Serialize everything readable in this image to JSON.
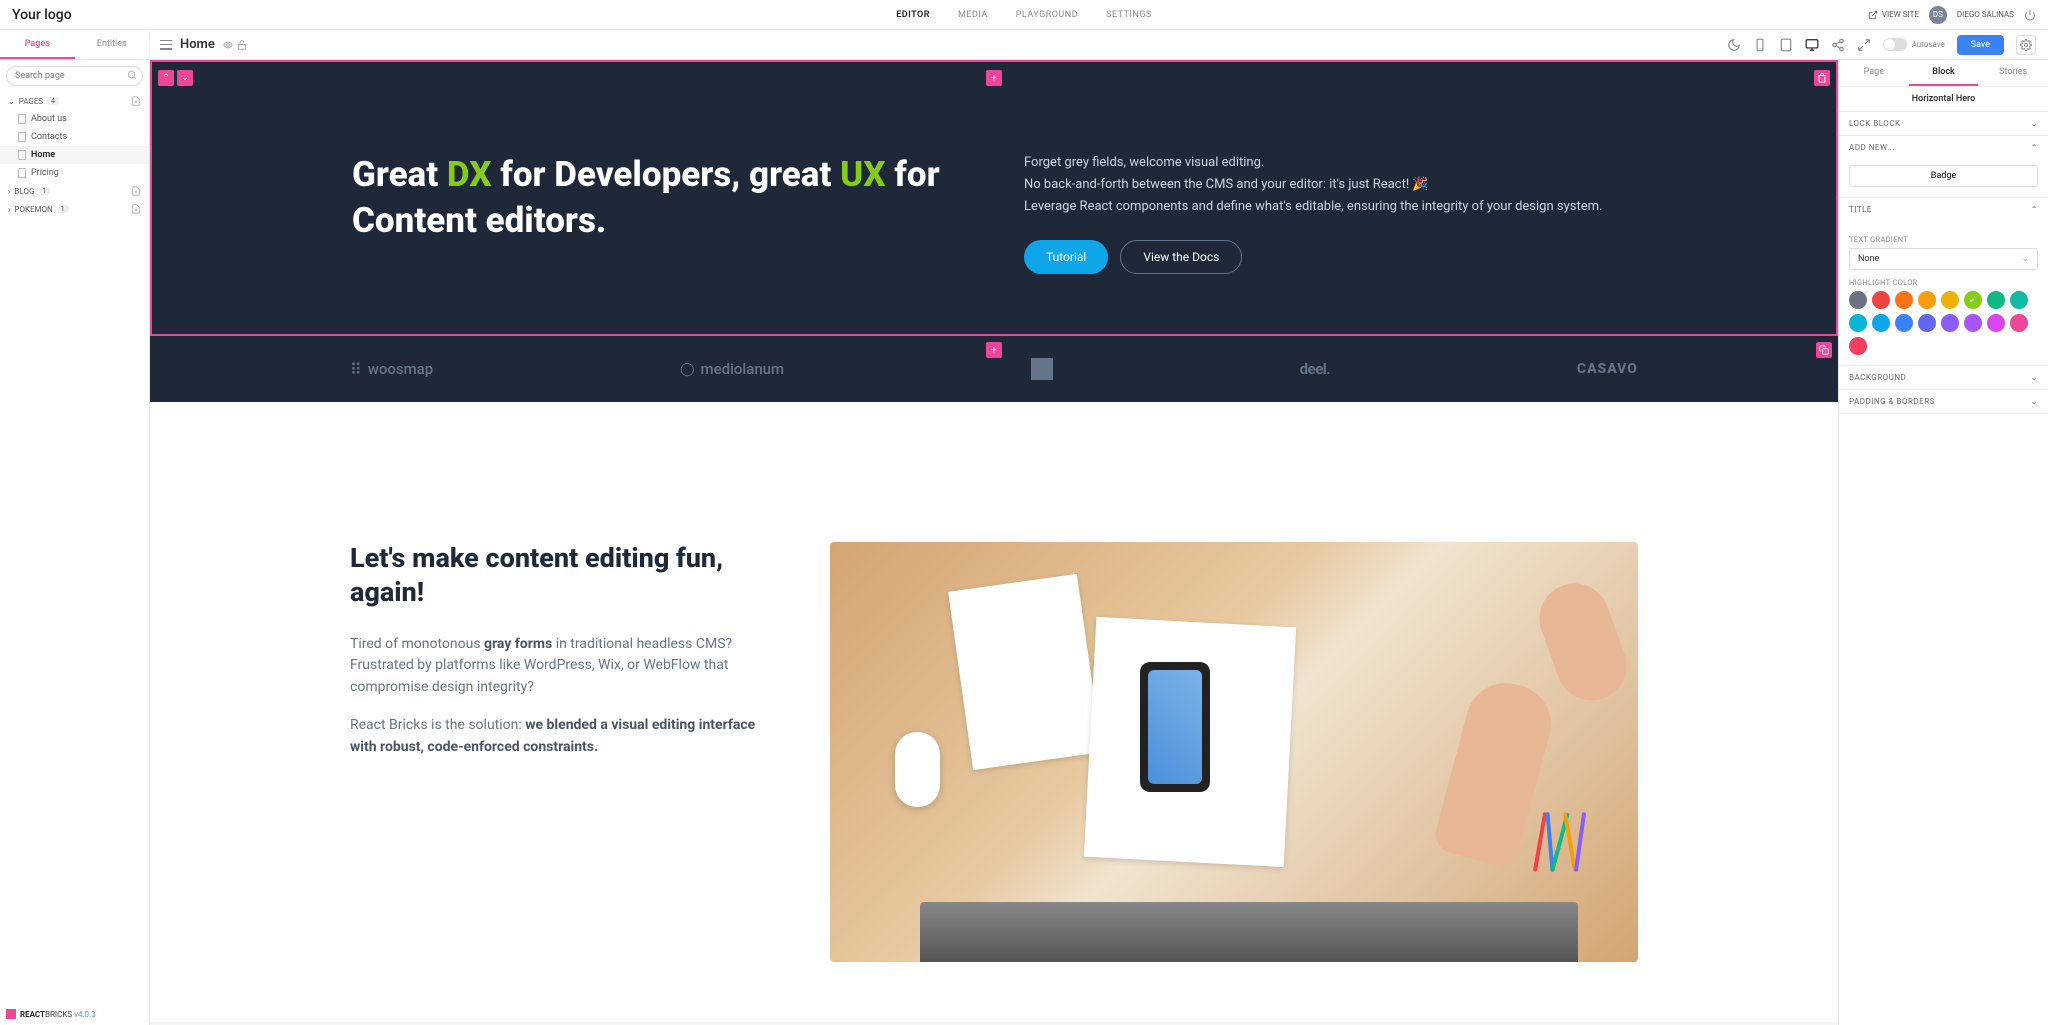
{
  "topnav": {
    "logo": "Your logo",
    "items": [
      "EDITOR",
      "MEDIA",
      "PLAYGROUND",
      "SETTINGS"
    ],
    "viewsite": "VIEW SITE",
    "avatar": "DS",
    "username": "DIEGO SALINAS"
  },
  "secondbar": {
    "tabs": [
      "Pages",
      "Entities"
    ],
    "pagename": "Home",
    "autosave": "Autosave",
    "save": "Save"
  },
  "sidebar": {
    "search_placeholder": "Search page",
    "sections": [
      {
        "label": "PAGES",
        "count": "4",
        "items": [
          {
            "label": "About us"
          },
          {
            "label": "Contacts"
          },
          {
            "label": "Home",
            "active": true
          },
          {
            "label": "Pricing"
          }
        ]
      },
      {
        "label": "BLOG",
        "count": "1",
        "items": []
      },
      {
        "label": "POKEMON",
        "count": "1",
        "items": []
      }
    ],
    "brand_1": "REACT",
    "brand_2": "BRICKS",
    "version": "v4.0.3"
  },
  "hero": {
    "title_1": "Great ",
    "title_hl1": "DX",
    "title_2": " for Developers, great ",
    "title_hl2": "UX",
    "title_3": " for Content editors.",
    "para_1": "Forget grey fields, welcome visual editing.",
    "para_2": "No back-and-forth between the CMS and your editor: it's just React! 🎉",
    "para_3": "Leverage React components and define what's editable, ensuring the integrity of your design system.",
    "btn_primary": "Tutorial",
    "btn_outline": "View the Docs"
  },
  "logos": [
    "woosmap",
    "mediolanum",
    "",
    "deel.",
    "CASAVO"
  ],
  "content": {
    "title": "Let's make content editing fun, again!",
    "p1a": "Tired of monotonous ",
    "p1b": "gray forms",
    "p1c": " in traditional headless CMS? Frustrated by platforms like WordPress, Wix, or WebFlow that compromise design integrity?",
    "p2a": "React Bricks is the solution: ",
    "p2b": "we blended a visual editing interface with robust, code-enforced constraints."
  },
  "rightpanel": {
    "tabs": [
      "Page",
      "Block",
      "Stories"
    ],
    "block_name": "Horizontal Hero",
    "lock": "LOCK BLOCK",
    "addnew": "ADD NEW...",
    "badge_btn": "Badge",
    "title_section": "TITLE",
    "text_gradient": "TEXT GRADIENT",
    "gradient_value": "None",
    "highlight": "HIGHLIGHT COLOR",
    "colors": [
      "#6b7280",
      "#ef4444",
      "#f97316",
      "#f59e0b",
      "#eab308",
      "#84cc16",
      "#10b981",
      "#14b8a6",
      "#06b6d4",
      "#0ea5e9",
      "#3b82f6",
      "#6366f1",
      "#8b5cf6",
      "#a855f7",
      "#d946ef",
      "#ec4899",
      "#f43f5e"
    ],
    "selected_color_index": 5,
    "background": "BACKGROUND",
    "padding": "PADDING & BORDERS"
  }
}
